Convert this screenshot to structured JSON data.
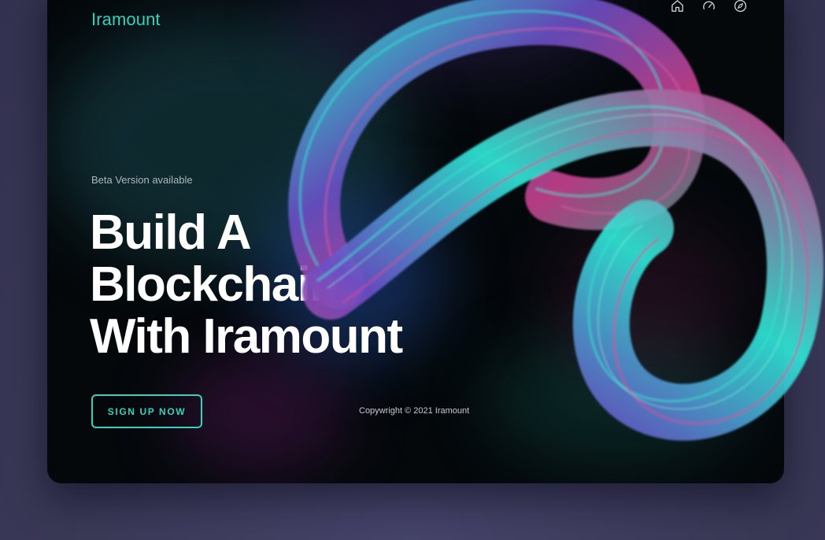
{
  "brand": {
    "logo_text": "Iramount",
    "accent_color": "#35d2bd"
  },
  "nav": {
    "items": [
      {
        "icon": "home-icon"
      },
      {
        "icon": "speedometer-icon"
      },
      {
        "icon": "compass-icon"
      }
    ]
  },
  "hero": {
    "tagline": "Beta Version available",
    "headline_lines": [
      "Build A",
      "Blockchain",
      "With Iramount"
    ],
    "cta_label": "SIGN UP NOW"
  },
  "footer": {
    "copyright": "Copywright © 2021 Iramount"
  },
  "artwork": {
    "name": "ribbon-3d-artwork",
    "colors": [
      "#2ee6d6",
      "#c8418f",
      "#6a4fc6",
      "#2fa887"
    ]
  }
}
